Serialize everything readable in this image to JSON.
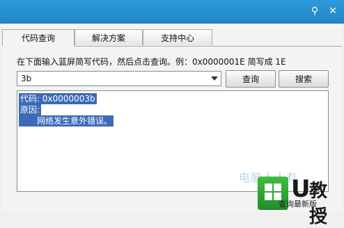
{
  "titlebar": {
    "accent_color": "#2a93d3",
    "search_icon": "magnifier-icon",
    "close_icon": "close-icon"
  },
  "tabs": [
    {
      "label": "代码查询",
      "active": true
    },
    {
      "label": "解决方案",
      "active": false
    },
    {
      "label": "支持中心",
      "active": false
    }
  ],
  "instruction": "在下面输入蓝屏简写代码，然后点击查询。例：0x0000001E 简写成 1E",
  "input": {
    "value": "3b"
  },
  "buttons": {
    "query": "查询",
    "search": "搜索"
  },
  "result": {
    "code_line": "代码: 0x0000003b",
    "reason_label": "原因:",
    "reason_text": "网络发生意外错误。"
  },
  "watermark": "电脑人人有",
  "status": "查询最新版",
  "logo": {
    "letter": "U",
    "text": "教授"
  }
}
